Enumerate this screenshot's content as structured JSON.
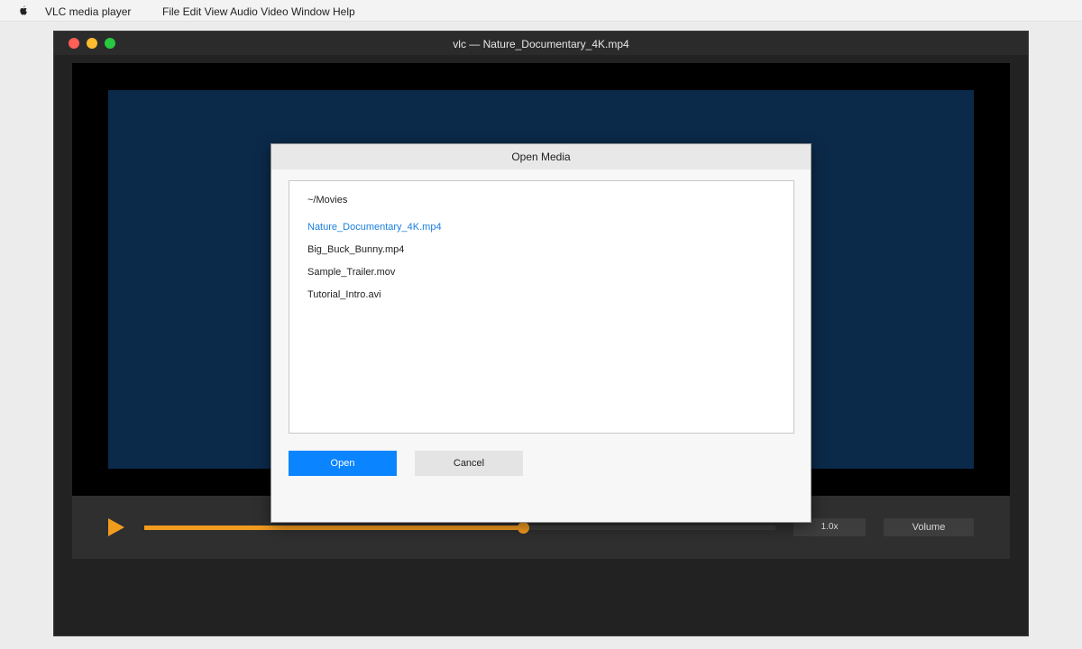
{
  "menubar": {
    "app_name": "VLC media player",
    "menu_items": "File Edit View Audio Video Window Help"
  },
  "window": {
    "title": "vlc — Nature_Documentary_4K.mp4"
  },
  "controls": {
    "progress": 0.6,
    "speed_label": "1.0x",
    "volume_label": "Volume"
  },
  "dialog": {
    "title": "Open Media",
    "path": "~/Movies",
    "files": [
      {
        "name": "Nature_Documentary_4K.mp4",
        "selected": true
      },
      {
        "name": "Big_Buck_Bunny.mp4",
        "selected": false
      },
      {
        "name": "Sample_Trailer.mov",
        "selected": false
      },
      {
        "name": "Tutorial_Intro.avi",
        "selected": false
      }
    ],
    "open_label": "Open",
    "cancel_label": "Cancel"
  },
  "colors": {
    "accent": "#f29c1f",
    "primary_button": "#0a84ff",
    "selected_file": "#1a7fe0",
    "video_background": "#0b2a4a"
  },
  "icons": {
    "apple": "apple-icon",
    "play": "play-icon"
  }
}
